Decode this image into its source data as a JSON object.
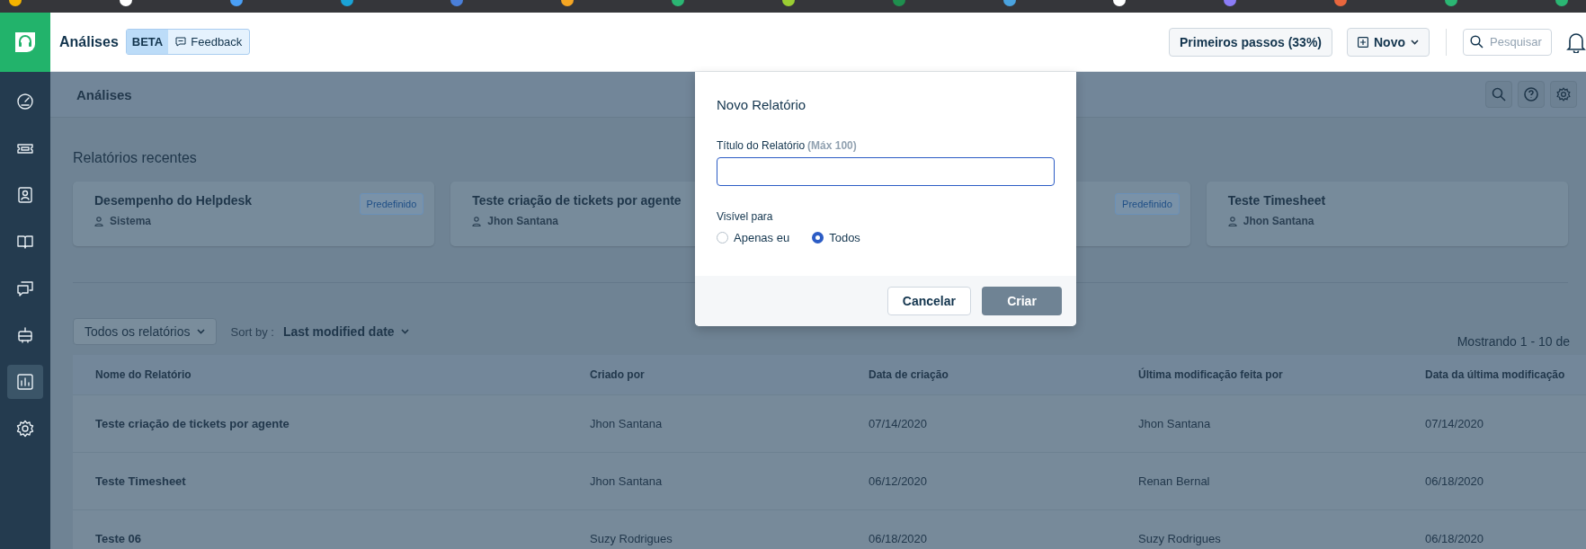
{
  "browser_bar": {
    "favicons": [
      {
        "color": "#f4b400"
      },
      {
        "color": "#ffffff"
      },
      {
        "color": "#4a9ff5"
      },
      {
        "color": "#1aa3d6"
      },
      {
        "color": "#4a7fd9"
      },
      {
        "color": "#f5a623"
      },
      {
        "color": "#2bb673"
      },
      {
        "color": "#9acd32"
      },
      {
        "color": "#1f8f4e"
      },
      {
        "color": "#4aa3df"
      },
      {
        "color": "#ffffff"
      },
      {
        "color": "#8b7cf6"
      },
      {
        "color": "#e8663d"
      },
      {
        "color": "#2bb673"
      },
      {
        "color": "#2bb673"
      }
    ]
  },
  "app_header": {
    "title": "Análises",
    "beta_badge": "BETA",
    "feedback_button": "Feedback",
    "onboarding_button": "Primeiros passos (33%)",
    "new_button": "Novo",
    "search": {
      "placeholder": "Pesquisar"
    }
  },
  "sidebar": {
    "items": [
      {
        "selected": false
      },
      {
        "selected": false
      },
      {
        "selected": false
      },
      {
        "selected": false
      },
      {
        "selected": false
      },
      {
        "selected": false
      },
      {
        "selected": true
      },
      {
        "selected": false
      }
    ]
  },
  "page_header": {
    "title": "Análises"
  },
  "recent_reports": {
    "title": "Relatórios recentes",
    "cards": [
      {
        "title": "Desempenho do Helpdesk",
        "author": "Sistema",
        "badge": "Predefinido"
      },
      {
        "title": "Teste criação de tickets por agente",
        "author": "Jhon Santana"
      },
      {
        "badge": "Predefinido"
      },
      {
        "title": "Teste Timesheet",
        "author": "Jhon Santana"
      }
    ]
  },
  "filters": {
    "view_dropdown": "Todos os relatórios",
    "sort_label": "Sort by :",
    "sort_dropdown": "Last modified date",
    "count": "Mostrando 1 - 10 de"
  },
  "table": {
    "columns": [
      "Nome do Relatório",
      "Criado por",
      "Data de criação",
      "Última modificação feita por",
      "Data da última modificação"
    ],
    "rows": [
      [
        "Teste criação de tickets por agente",
        "Jhon Santana",
        "07/14/2020",
        "Jhon Santana",
        "07/14/2020"
      ],
      [
        "Teste Timesheet",
        "Jhon Santana",
        "06/12/2020",
        "Renan Bernal",
        "06/18/2020"
      ],
      [
        "Teste 06",
        "Suzy Rodrigues",
        "06/18/2020",
        "Suzy Rodrigues",
        "06/18/2020"
      ]
    ]
  },
  "modal": {
    "title": "Novo Relatório",
    "title_label": "Título do Relatório",
    "title_hint": "(Máx 100)",
    "visibility_label": "Visível para",
    "options": [
      {
        "label": "Apenas eu",
        "selected": false
      },
      {
        "label": "Todos",
        "selected": true
      }
    ],
    "cancel": "Cancelar",
    "create": {
      "label": "Criar",
      "disabled": true
    }
  }
}
